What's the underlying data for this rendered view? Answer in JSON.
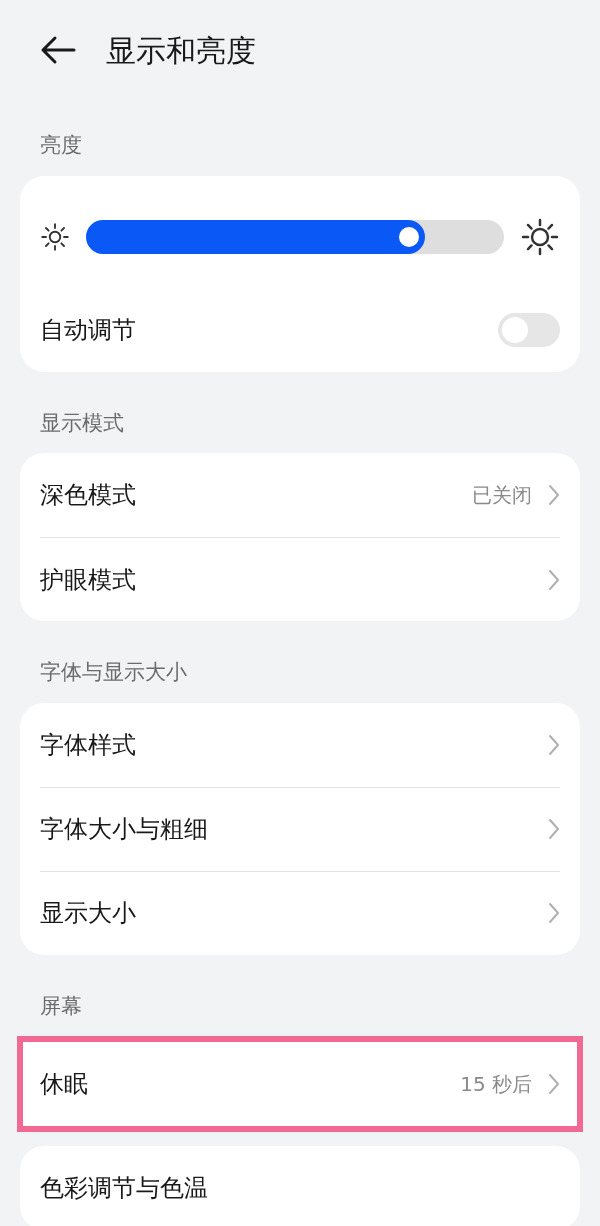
{
  "title": "显示和亮度",
  "groups": [
    {
      "label": "亮度",
      "cards": [
        {
          "highlighted": false,
          "items": [
            {
              "kind": "slider",
              "level": 0.81
            },
            {
              "kind": "toggle",
              "label": "自动调节",
              "on": false
            }
          ]
        }
      ]
    },
    {
      "label": "显示模式",
      "cards": [
        {
          "highlighted": false,
          "items": [
            {
              "kind": "link",
              "label": "深色模式",
              "value": "已关闭"
            },
            {
              "kind": "link",
              "label": "护眼模式"
            }
          ]
        }
      ]
    },
    {
      "label": "字体与显示大小",
      "cards": [
        {
          "highlighted": false,
          "items": [
            {
              "kind": "link",
              "label": "字体样式"
            },
            {
              "kind": "link",
              "label": "字体大小与粗细"
            },
            {
              "kind": "link",
              "label": "显示大小"
            }
          ]
        }
      ]
    },
    {
      "label": "屏幕",
      "cards": [
        {
          "highlighted": true,
          "items": [
            {
              "kind": "link",
              "label": "休眠",
              "value": "15 秒后"
            }
          ]
        },
        {
          "highlighted": false,
          "items": [
            {
              "kind": "plain",
              "label": "色彩调节与色温"
            }
          ]
        }
      ]
    }
  ]
}
